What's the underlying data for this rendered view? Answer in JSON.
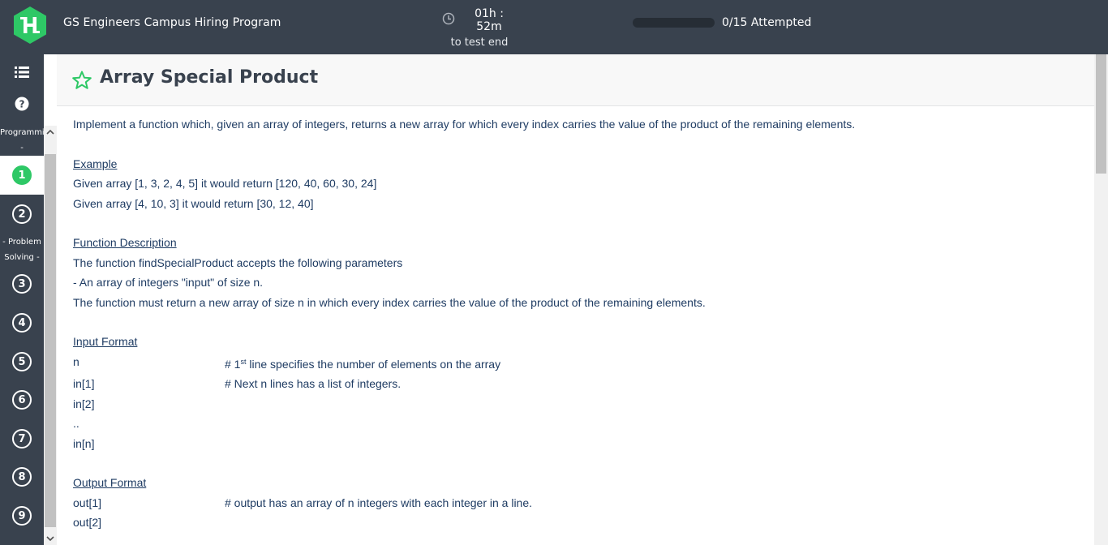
{
  "header": {
    "program_title": "GS Engineers Campus Hiring Program",
    "timer_value": "01h : 52m",
    "timer_sub": "to test end",
    "progress_text": "0/15 Attempted",
    "progress_fraction": 0
  },
  "sidebar": {
    "sections": [
      "Programmin",
      "-",
      "- Problem",
      "Solving -"
    ],
    "questions": [
      "1",
      "2",
      "3",
      "4",
      "5",
      "6",
      "7",
      "8",
      "9"
    ],
    "active_question": "1"
  },
  "question": {
    "title": "Array Special Product",
    "intro": "Implement a function which, given an array of integers, returns a new array for which every index carries the value of the product of the remaining elements.",
    "example_heading": "Example",
    "example_lines": [
      "Given array [1, 3, 2, 4, 5] it would return [120, 40, 60, 30, 24]",
      "Given array [4, 10, 3] it would return [30, 12, 40]"
    ],
    "function_heading": "Function Description",
    "function_lines": [
      "The function findSpecialProduct accepts the following parameters",
      "- An array of integers \"input\" of size n.",
      "The function must return a new array of size n in which every index carries the value of the product of the remaining elements."
    ],
    "input_heading": "Input Format",
    "input_rows": [
      {
        "left": "n",
        "right_prefix": "# 1",
        "right_sup": "st",
        "right_suffix": " line specifies the number of elements on the array"
      },
      {
        "left": "in[1]",
        "right": "# Next n lines has a list of integers."
      },
      {
        "left": "in[2]",
        "right": ""
      },
      {
        "left": "..",
        "right": ""
      },
      {
        "left": "in[n]",
        "right": ""
      }
    ],
    "output_heading": "Output Format",
    "output_rows": [
      {
        "left": "out[1]",
        "right": "# output has an array of n integers with each integer in a line."
      },
      {
        "left": "out[2]",
        "right": ""
      },
      {
        "left": "...",
        "right": ""
      }
    ]
  }
}
